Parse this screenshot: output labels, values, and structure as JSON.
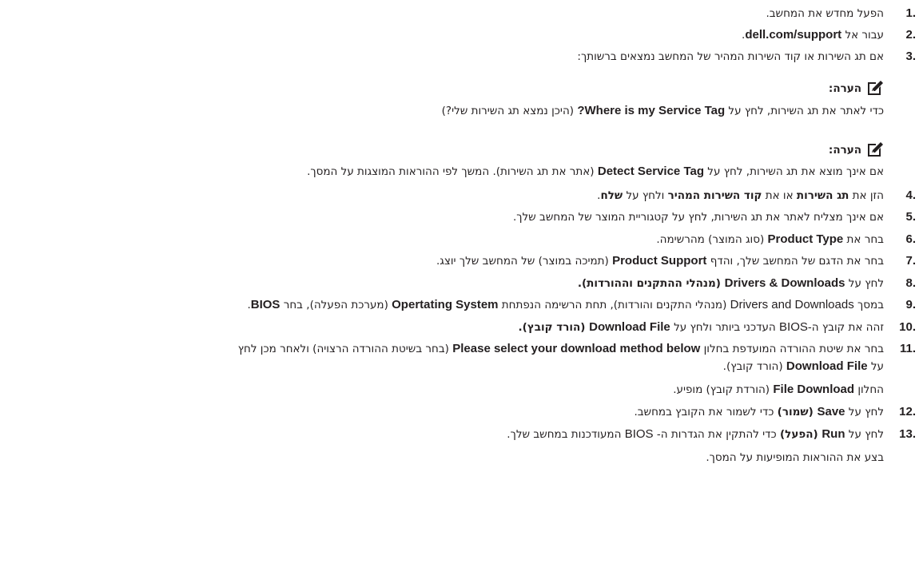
{
  "steps": [
    {
      "num": "1.",
      "parts": {
        "a": "הפעל מחדש את המחשב."
      }
    },
    {
      "num": "2.",
      "parts": {
        "a": "עבור אל ",
        "b": "dell.com/support",
        "c": "."
      }
    },
    {
      "num": "3.",
      "parts": {
        "a": "אם תג השירות או קוד השירות המהיר של המחשב נמצאים ברשותך:"
      }
    },
    {
      "num": "4.",
      "parts": {
        "a": "הזן את ",
        "b": "תג השירות",
        "c": " או את ",
        "d": "קוד השירות המהיר",
        "e": " ולחץ על ",
        "f": "שלח",
        "g": "."
      }
    },
    {
      "num": "5.",
      "parts": {
        "a": "אם אינך מצליח לאתר את תג השירות, לחץ על קטגוריית המוצר של המחשב שלך."
      }
    },
    {
      "num": "6.",
      "parts": {
        "a": "בחר את ",
        "b": "Product Type",
        "c": " (סוג המוצר) מהרשימה."
      }
    },
    {
      "num": "7.",
      "parts": {
        "a": "בחר את הדגם של המחשב שלך, והדף ",
        "b": "Product Support",
        "c": " (תמיכה במוצר) של המחשב שלך יוצג."
      }
    },
    {
      "num": "8.",
      "parts": {
        "a": "לחץ על ",
        "b": "Drivers & Downloads",
        "c": " (מנהלי ההתקנים וההורדות)."
      }
    },
    {
      "num": "9.",
      "parts": {
        "a": "במסך ",
        "b": "Drivers and Downloads",
        "c": " (מנהלי התקנים והורדות), תחת הרשימה הנפתחת ",
        "d": "Opertating System",
        "e": " (מערכת הפעלה), בחר ",
        "f": "BIOS",
        "g": "."
      }
    },
    {
      "num": "10.",
      "parts": {
        "a": "זהה את קובץ ה-",
        "b": "BIOS",
        "c": " העדכני ביותר ולחץ על ",
        "d": "Download File",
        "e": " (הורד קובץ)."
      }
    },
    {
      "num": "11.",
      "parts": {
        "a": "בחר את שיטת ההורדה המועדפת בחלון ",
        "b": "Please select your download method below",
        "c": " (בחר בשיטת ההורדה הרצויה) ולאחר מכן לחץ"
      }
    },
    {
      "num": "12.",
      "parts": {
        "a": "לחץ על ",
        "b": "Save",
        "c": " (שמור)",
        "d": " כדי לשמור את הקובץ במחשב."
      }
    },
    {
      "num": "13.",
      "parts": {
        "a": "לחץ על ",
        "b": "Run",
        "c": " (הפעל)",
        "d": " כדי להתקין את הגדרות ה- ",
        "e": "BIOS",
        "f": " המעודכנות במחשב שלך."
      }
    }
  ],
  "step11_line2": {
    "a": "על ",
    "b": "Download File",
    "c": " (הורד קובץ)."
  },
  "step11_line3": {
    "a": "החלון ",
    "b": "File Download",
    "c": " (הורדת קובץ) מופיע."
  },
  "step13_line2": "בצע את ההוראות המופיעות על המסך.",
  "notes": [
    {
      "label": "הערה:",
      "parts": {
        "a": "כדי לאתר את תג השירות, לחץ על ",
        "b": "Where is my Service Tag?",
        "c": " (היכן נמצא תג השירות שלי?)"
      }
    },
    {
      "label": "הערה:",
      "parts": {
        "a": "אם אינך מוצא את תג השירות, לחץ על ",
        "b": "Detect Service Tag",
        "c": " (אתר את תג השירות). המשך לפי ההוראות המוצגות על המסך."
      }
    }
  ],
  "icons": {
    "note": "pencil-note-icon"
  },
  "colors": {
    "text": "#231f20",
    "icon": "#231f20"
  }
}
